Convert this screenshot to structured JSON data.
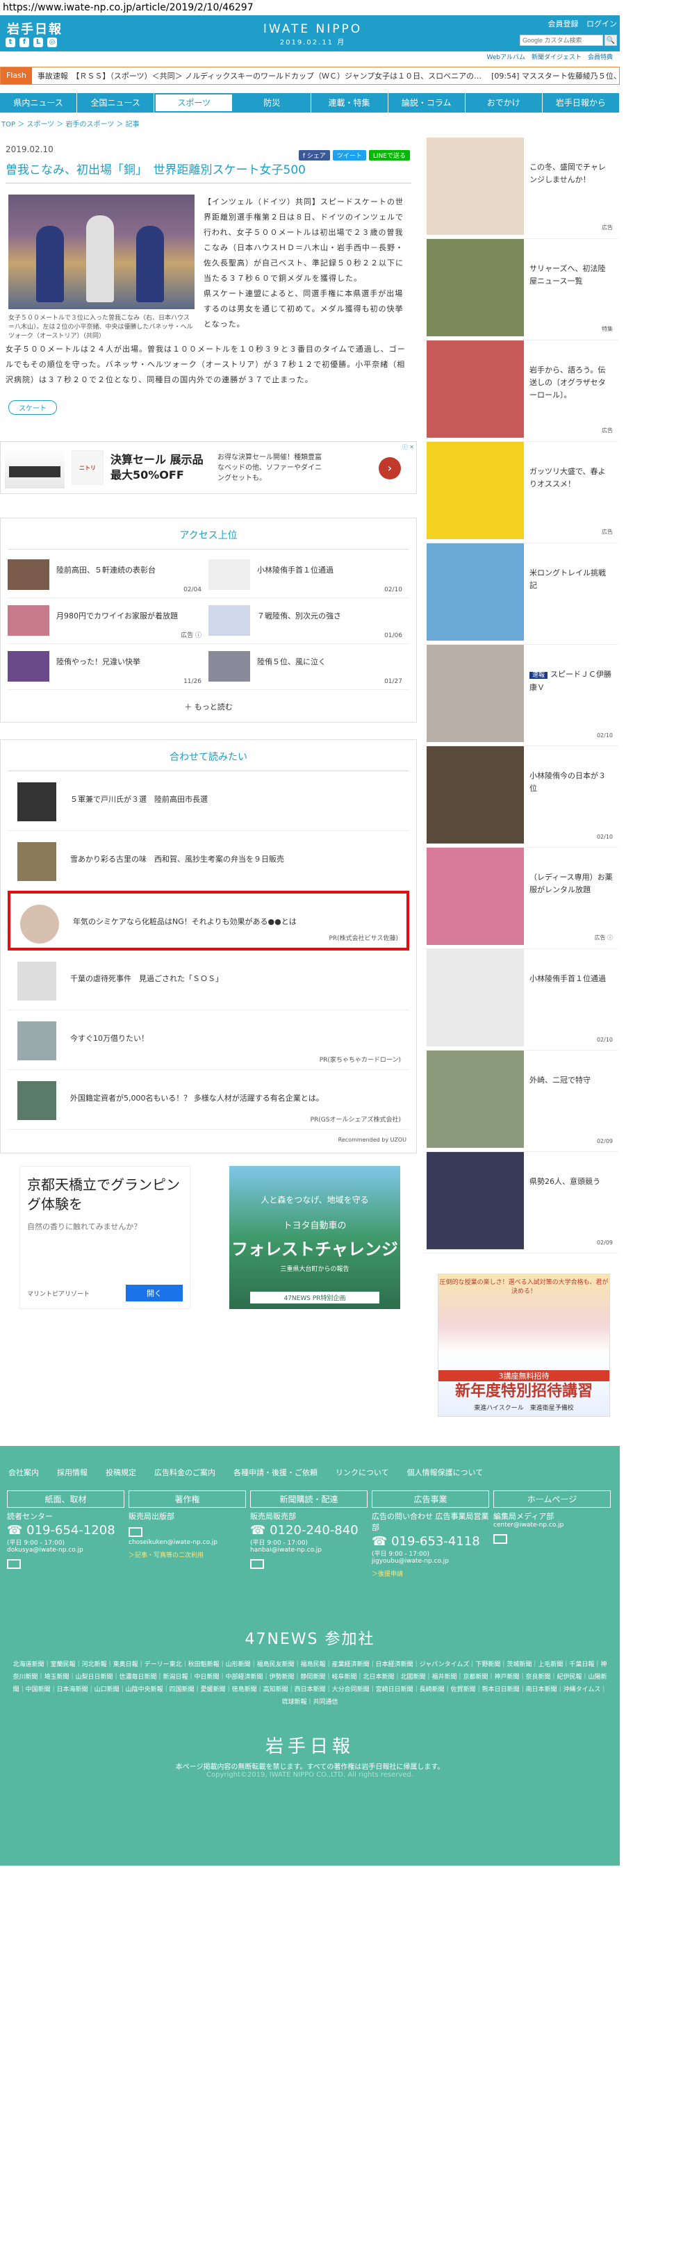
{
  "browser": {
    "url": "https://www.iwate-np.co.jp/article/2019/2/10/46297"
  },
  "header": {
    "logo": "岩手日報",
    "center_title": "IWATE NIPPO",
    "center_date": "2019.02.11 月",
    "login_links": [
      "会員登録",
      "ログイン"
    ],
    "search_placeholder": "Google カスタム検索",
    "search_button": "🔍",
    "sub_links": "Webアルバム　新聞ダイジェスト　会員特典"
  },
  "flash": {
    "label": "Flash",
    "items": [
      "事故速報　【ＲＳＳ】（スポーツ）＜共同＞ ノルディックスキーのワールドカップ（ＷＣ）ジャンプ女子は１０日、スロベニアの…",
      "[09:54] マススタート佐藤綾乃５位、"
    ]
  },
  "nav": [
    "県内ニュース",
    "全国ニュース",
    "スポーツ",
    "防災",
    "連載・特集",
    "論説・コラム",
    "おでかけ",
    "岩手日報から"
  ],
  "breadcrumb": "TOP ＞ スポーツ ＞ 岩手のスポーツ ＞ 記事",
  "article": {
    "date": "2019.02.10",
    "share": [
      "f シェア",
      "ツイート",
      "LINEで送る"
    ],
    "title": "曽我こなみ、初出場「銅」　世界距離別スケート女子500",
    "caption": "女子５００メートルで３位に入った曽我こなみ（右、日本ハウス＝八木山）。左は２位の小平奈緒、中央は優勝したバネッサ・ヘルツォーク（オーストリア）（共同）",
    "para1": "【インツェル（ドイツ）共同】スピードスケートの世界距離別選手権第２日は８日、ドイツのインツェルで行われ、女子５００メートルは初出場で２３歳の曽我こなみ（日本ハウスＨＤ＝八木山・岩手西中－長野・佐久長聖高）が自己ベスト、準記録５０秒２２以下に当たる３７秒６０で銅メダルを獲得した。\n県スケート連盟によると、同選手権に本県選手が出場するのは男女を通じて初めて。メダル獲得も初の快挙となった。",
    "para2": "女子５００メートルは２４人が出場。曽我は１００メートルを１０秒３９と３番目のタイムで通過し、ゴールでもその順位を守った。バネッサ・ヘルツォーク（オーストリア）が３７秒１２で初優勝。小平奈緒（相沢病院）は３７秒２０で２位となり、同種目の国内外での連勝が３７で止まった。",
    "tag": "スケート"
  },
  "ad_banner": {
    "logo": "ニトリ",
    "headline": "決算セール 展示品最大50%OFF",
    "sub": "お得な決算セール開催！種類豊富なベッドの他、ソファーやダイニングセットも。",
    "choices": "ⓘ ✕"
  },
  "access": {
    "title": "アクセス上位",
    "items": [
      {
        "title": "陸前高田、５軒連続の表彰台",
        "date": "02/04"
      },
      {
        "title": "小林陵侑手首１位通過",
        "date": "02/10"
      },
      {
        "title": "月980円でカワイイお家服が着放題",
        "date": "広告 ⓘ"
      },
      {
        "title": "７戦陸侑、別次元の強さ",
        "date": "01/06"
      },
      {
        "title": "陸侑やった！兄違い快挙",
        "date": "11/26"
      },
      {
        "title": "陸侑５位、風に泣く",
        "date": "01/27"
      }
    ],
    "more": "＋ もっと読む"
  },
  "related": {
    "title": "合わせて読みたい",
    "items": [
      {
        "title": "５軍兼で戸川氏が３選　陸前高田市長選",
        "pr": ""
      },
      {
        "title": "雪あかり彩る古里の味　西和賀、風抄生考案の弁当を９日販売",
        "pr": ""
      },
      {
        "title": "年気のシミケアなら化粧品はNG！それよりも効果がある●●とは",
        "pr": "PR(株式会社ビサス佐藤)"
      },
      {
        "title": "千葉の虐待死事件　見過ごされた「ＳＯＳ」",
        "pr": ""
      },
      {
        "title": "今すぐ10万借りたい！",
        "pr": "PR(家ちゃちゃカードローン)"
      },
      {
        "title": "外国籍定資者が5,000名もいる！？ 多様な人材が活躍する有名企業とは。",
        "pr": "PR(GSオールシェアズ株式会社)"
      }
    ],
    "rec": "Recommended by UZOU"
  },
  "ads": {
    "kyoto": {
      "headline": "京都天橋立でグランピング体験を",
      "sub": "自然の香りに触れてみませんか？",
      "brand": "マリントピアリゾート",
      "button": "開く"
    },
    "toyota": {
      "a": "人と森をつなげ、地域を守る",
      "b": "トヨタ自動車の",
      "c": "フォレストチャレンジ",
      "d": "三重県大台町からの報告",
      "e": "47NEWS PR特別企画"
    }
  },
  "sidebar": {
    "items": [
      {
        "title": "この冬、盛岡でチャレンジしませんか！",
        "meta": "広告",
        "badge": ""
      },
      {
        "title": "サリャーズへ、初法陸屋ニュース一覧",
        "meta": "特集",
        "badge": ""
      },
      {
        "title": "岩手から、語ろう。伝送しの〔オグラザセターロール〕。",
        "meta": "広告",
        "badge": ""
      },
      {
        "title": "ガッツリ大盛で、春よりオススメ！",
        "meta": "広告",
        "badge": ""
      },
      {
        "title": "米ロングトレイル挑戦記",
        "meta": "",
        "badge": ""
      },
      {
        "title": "スピードＪＣ伊勝康Ｖ",
        "meta": "02/10",
        "badge": "速報"
      },
      {
        "title": "小林陵侑今の日本が３位",
        "meta": "02/10",
        "badge": ""
      },
      {
        "title": "（レディース専用）お薬服がレンタル放題",
        "meta": "広告 ⓘ",
        "badge": ""
      },
      {
        "title": "小林陵侑手首１位通過",
        "meta": "02/10",
        "badge": ""
      },
      {
        "title": "外崎、二冠で特守",
        "meta": "02/09",
        "badge": ""
      },
      {
        "title": "県勢26人、意頭競う",
        "meta": "02/09",
        "badge": ""
      }
    ],
    "ad": {
      "a": "圧倒的な授業の楽しさ！選べる入試対策の大学合格も、君が決める！",
      "b": "3講座無料招待",
      "c": "新年度特別招待講習",
      "d": "東進ハイスクール　東進衛星予備校"
    }
  },
  "footer": {
    "nav": [
      "会社案内",
      "採用情報",
      "投稿規定",
      "広告料金のご案内",
      "各種申請・後援・ご依頼",
      "リンクについて",
      "個人情報保護について"
    ],
    "cols": [
      {
        "head": "紙面、取材",
        "t": "読者センター",
        "tel": "019-654-1208",
        "sm": "(平日 9:00 - 17:00)",
        "mail": "dokusya@iwate-np.co.jp",
        "lk": ""
      },
      {
        "head": "著作権",
        "t": "販売局出版部",
        "tel": "",
        "sm": "",
        "mail": "choseikuken@iwate-np.co.jp",
        "lk": "＞記事・写真等の二次利用"
      },
      {
        "head": "新聞購読・配達",
        "t": "販売局販売部",
        "tel": "0120-240-840",
        "sm": "(平日 9:00 - 17:00)",
        "mail": "hanbai@iwate-np.co.jp",
        "lk": ""
      },
      {
        "head": "広告事業",
        "t": "広告の問い合わせ 広告事業局営業部",
        "tel": "019-653-4118",
        "sm": "(平日 9:00 - 17:00)",
        "mail": "jigyoubu@iwate-np.co.jp",
        "lk": "＞後援申請"
      },
      {
        "head": "ホームページ",
        "t": "編集局メディア部",
        "tel": "",
        "sm": "",
        "mail": "center@iwate-np.co.jp",
        "lk": ""
      }
    ],
    "n47": "47NEWS 参加社",
    "papers": "北海道新聞｜室蘭民報｜河北新報｜東奥日報｜デーリー東北｜秋田魁新報｜山形新聞｜福島民友新聞｜福島民報｜産業経済新聞｜日本経済新聞｜ジャパンタイムズ｜下野新聞｜茨城新聞｜上毛新聞｜千葉日報｜神奈川新聞｜埼玉新聞｜山梨日日新聞｜信濃毎日新聞｜新潟日報｜中日新聞｜中部経済新聞｜伊勢新聞｜静岡新聞｜岐阜新聞｜北日本新聞｜北國新聞｜福井新聞｜京都新聞｜神戸新聞｜奈良新聞｜紀伊民報｜山陽新聞｜中国新聞｜日本海新聞｜山口新聞｜山陰中央新報｜四国新聞｜愛媛新聞｜徳島新聞｜高知新聞｜西日本新聞｜大分合同新聞｜宮崎日日新聞｜長崎新聞｜佐賀新聞｜熊本日日新聞｜南日本新聞｜沖縄タイムス｜琉球新報｜共同通信",
    "logo": "岩手日報",
    "copy": "本ページ掲載内容の無断転載を禁じます。すべての著作権は岩手日報社に帰属します。",
    "copy2": "Copyright©2019, IWATE NIPPO CO.,LTD. All rights reserved."
  }
}
